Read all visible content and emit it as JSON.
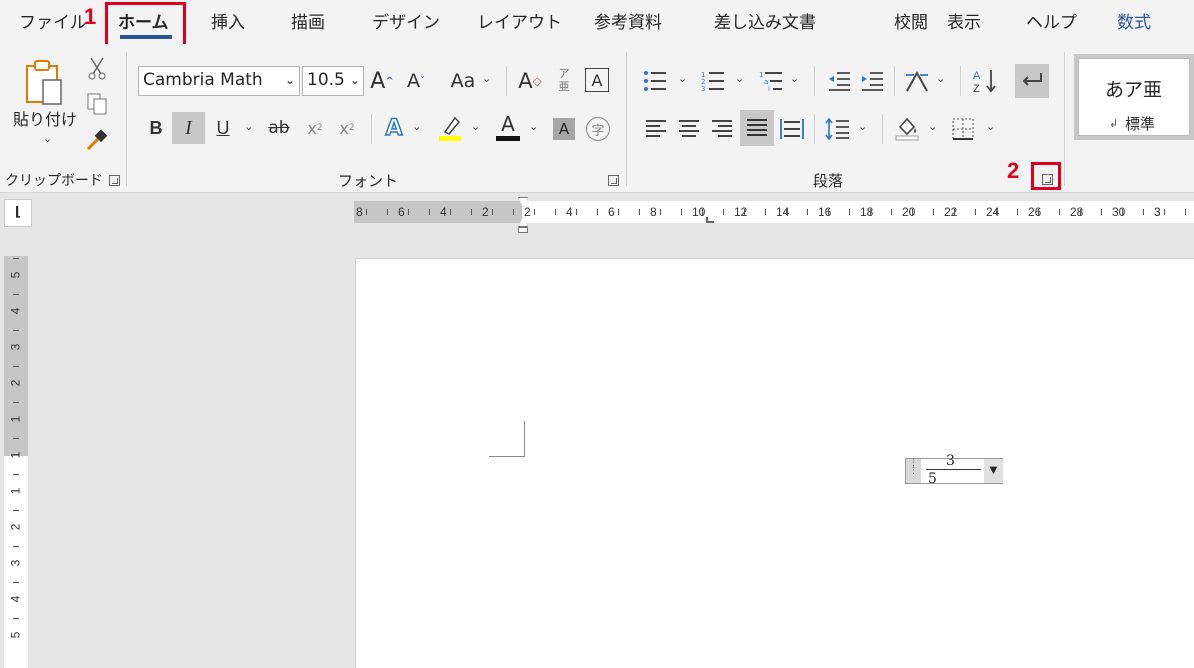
{
  "tabs": [
    {
      "label": "ファイル"
    },
    {
      "label": "ホーム"
    },
    {
      "label": "挿入"
    },
    {
      "label": "描画"
    },
    {
      "label": "デザイン"
    },
    {
      "label": "レイアウト"
    },
    {
      "label": "参考資料"
    },
    {
      "label": "差し込み文書"
    },
    {
      "label": "校閲"
    },
    {
      "label": "表示"
    },
    {
      "label": "ヘルプ"
    },
    {
      "label": "数式"
    }
  ],
  "steps": {
    "one": "1",
    "two": "2"
  },
  "clipboard": {
    "paste_label": "貼り付け",
    "group_label": "クリップボード"
  },
  "font": {
    "name": "Cambria Math",
    "size": "10.5",
    "group_label": "フォント",
    "grow": "A",
    "shrink": "A",
    "case": "Aa",
    "clear_format": "A",
    "ruby_top": "ア",
    "ruby_bottom": "亜",
    "border_char": "A",
    "bold": "B",
    "italic": "I",
    "underline": "U",
    "strike": "ab",
    "sub": "x",
    "sup": "x",
    "effects": "A",
    "color": "A",
    "shade": "A",
    "enclose": "字"
  },
  "paragraph": {
    "group_label": "段落"
  },
  "styles": {
    "sample": "あア亜",
    "name": "標準",
    "para_mark": "↲"
  },
  "ruler": {
    "h_ticks": [
      "8",
      "6",
      "4",
      "2",
      "2",
      "4",
      "6",
      "8",
      "10",
      "12",
      "14",
      "16",
      "18",
      "20",
      "22",
      "24",
      "26",
      "28",
      "30",
      "3"
    ],
    "v_ticks": [
      "5",
      "4",
      "3",
      "2",
      "1",
      "1",
      "1",
      "2",
      "3",
      "4",
      "5"
    ]
  },
  "equation": {
    "numerator": "3",
    "denominator": "5"
  },
  "colors": {
    "accent": "#2b579a",
    "highlight": "#ffff00",
    "annotation": "#e0001b",
    "selected": "#c8c8c8"
  }
}
